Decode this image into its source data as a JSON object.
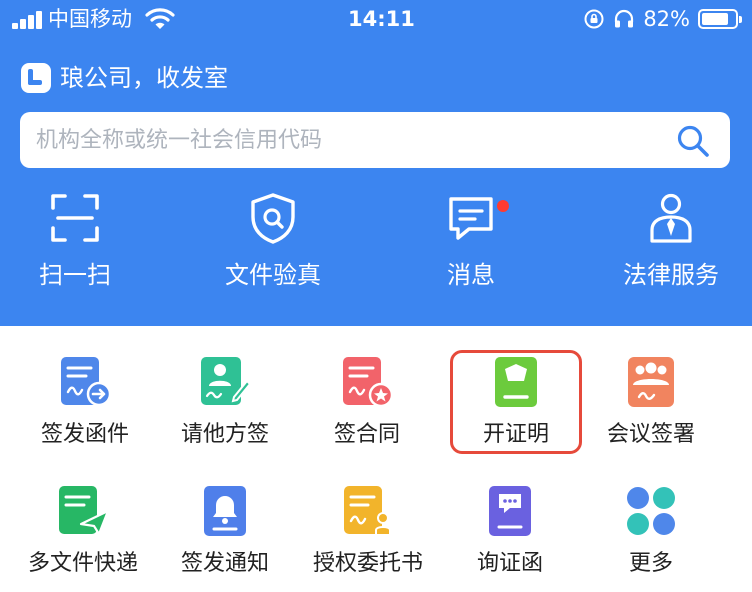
{
  "status_bar": {
    "carrier": "中国移动",
    "time": "14:11",
    "battery": "82%"
  },
  "header": {
    "org_name": "琅公司，收发室",
    "search_placeholder": "机构全称或统一社会信用代码"
  },
  "quick_actions": [
    {
      "label": "扫一扫",
      "icon": "scan-icon"
    },
    {
      "label": "文件验真",
      "icon": "verify-shield-icon"
    },
    {
      "label": "消息",
      "icon": "message-icon"
    },
    {
      "label": "法律服务",
      "icon": "lawyer-icon"
    }
  ],
  "services": [
    {
      "label": "签发函件",
      "icon": "issue-letter-icon"
    },
    {
      "label": "请他方签",
      "icon": "request-sign-icon"
    },
    {
      "label": "签合同",
      "icon": "sign-contract-icon"
    },
    {
      "label": "开证明",
      "icon": "certificate-icon"
    },
    {
      "label": "会议签署",
      "icon": "meeting-sign-icon"
    },
    {
      "label": "多文件快递",
      "icon": "multi-file-send-icon"
    },
    {
      "label": "签发通知",
      "icon": "notice-bell-icon"
    },
    {
      "label": "授权委托书",
      "icon": "authorization-icon"
    },
    {
      "label": "询证函",
      "icon": "inquiry-letter-icon"
    },
    {
      "label": "更多",
      "icon": "more-icon"
    }
  ],
  "colors": {
    "header_bg": "#3c85f0",
    "highlight_border": "#e64a3b",
    "badge_red": "#ff3b30"
  }
}
